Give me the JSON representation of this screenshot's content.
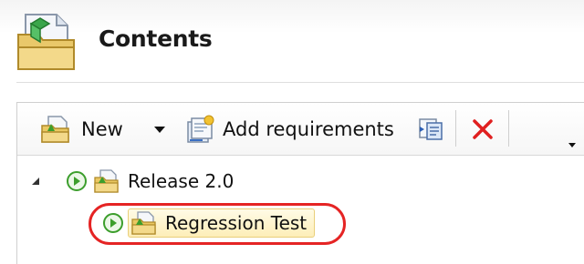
{
  "header": {
    "title": "Contents",
    "icon": "contents-folder-icon"
  },
  "toolbar": {
    "new_label": "New",
    "add_requirements_label": "Add requirements"
  },
  "tree": {
    "root": {
      "label": "Release 2.0",
      "expanded": true
    },
    "child": {
      "label": "Regression Test",
      "selected": true
    }
  },
  "colors": {
    "highlight_ring": "#e52424",
    "delete_icon": "#e02020",
    "play_icon": "#3c9e2c"
  }
}
